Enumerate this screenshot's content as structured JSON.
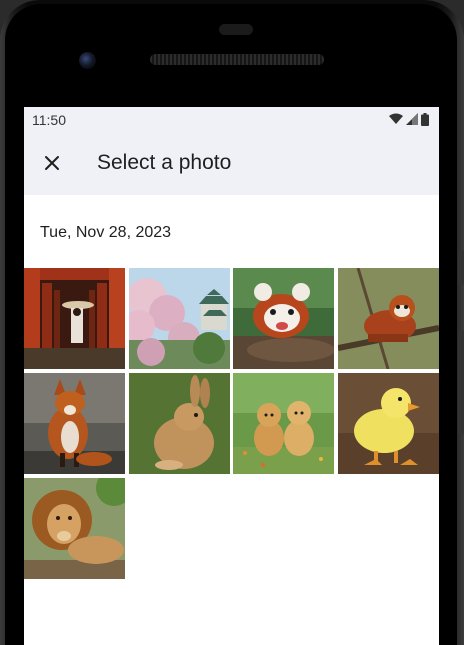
{
  "status": {
    "time": "11:50",
    "icons": [
      "wifi-icon",
      "signal-icon",
      "battery-icon"
    ]
  },
  "header": {
    "close_icon": "close-icon",
    "title": "Select a photo"
  },
  "section": {
    "date": "Tue, Nov 28, 2023"
  },
  "photos": [
    {
      "subject": "torii-gates-woman-kimono"
    },
    {
      "subject": "cherry-blossom-castle"
    },
    {
      "subject": "red-panda-on-log"
    },
    {
      "subject": "red-panda-in-tree"
    },
    {
      "subject": "red-fox"
    },
    {
      "subject": "rabbit"
    },
    {
      "subject": "two-puppies"
    },
    {
      "subject": "duckling"
    },
    {
      "subject": "lion"
    }
  ],
  "colors": {
    "appbar_bg": "#eff1f6",
    "screen_bg": "#ffffff",
    "text_primary": "#1f1f1f"
  }
}
